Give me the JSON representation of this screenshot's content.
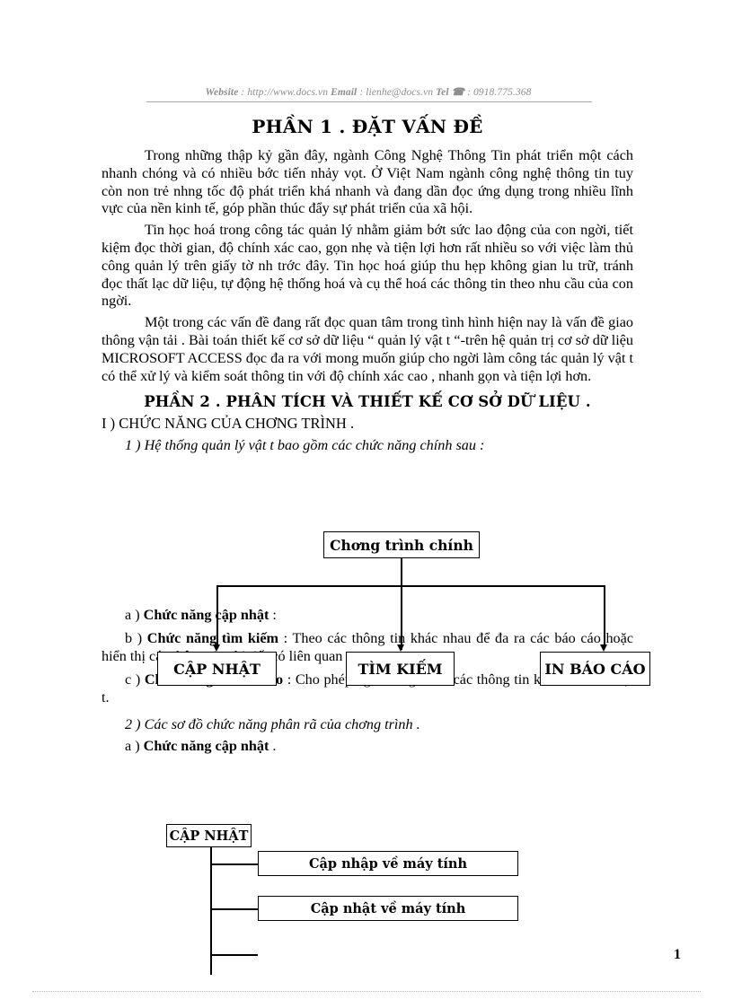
{
  "header": {
    "website_label": "Website",
    "website_sep": " : ",
    "website_url": "http://www.docs.vn",
    "email_label": "Email",
    "email_sep": "  : ",
    "email_value": "lienhe@docs.vn",
    "tel_label": "Tel",
    "tel_icon": "telephone-icon",
    "tel_glyph": "☎",
    "tel_sep": " : ",
    "tel_value": "0918.775.368"
  },
  "part1": {
    "title": "PHẦN 1 . ĐẶT VẤN ĐỀ",
    "paragraphs": [
      "Trong những thập kỷ gần đây, ngành Công Nghệ Thông Tin phát triển một cách nhanh chóng và có nhiều bớc   tiến nhảy vọt. Ở Việt Nam ngành công nghệ thông tin tuy còn non trẻ nhng   tốc độ phát triển khá nhanh và đang dần đọc   ứng dụng trong nhiều lĩnh vực của nền kinh tế, góp phần thúc đẩy sự phát triển của xã hội.",
      "Tin học hoá trong công tác quản lý nhằm giảm bớt sức lao động của con ngời,  tiết kiệm đọc   thời gian, độ chính xác cao, gọn nhẹ và tiện lợi hơn rất nhiều so với việc làm thủ công quản lý trên giấy tờ nh   trớc   đây. Tin học hoá giúp thu hẹp không gian lu   trữ, tránh đọc   thất lạc dữ liệu, tự động hệ thống hoá và cụ thể hoá các thông tin theo nhu cầu của con ngời.",
      "Một trong các vấn đề đang rất đọc   quan tâm trong tình hình hiện nay là vấn đề giao thông vận tải . Bài toán thiết kế cơ sở dữ liệu “ quản lý vật t  “-trên hệ quản trị cơ sở dữ liệu MICROSOFT ACCESS đọc   đa   ra với mong muốn giúp cho ngời   làm công tác quản lý vật t   có thể xử lý và kiểm soát thông tin với độ chính xác cao , nhanh gọn và tiện lợi hơn."
    ]
  },
  "part2": {
    "title": "PHẦN 2 . PHÂN TÍCH VÀ THIẾT KẾ CƠ SỞ DỮ LIỆU .",
    "section_1": "I ) CHỨC NĂNG CỦA CHƠNG   TRÌNH .",
    "item_1": "1 ) Hệ thống quản lý vật t   bao gồm các chức năng chính sau :",
    "item_2": "2 ) Các sơ đồ chức năng phân rã của chơng   trình ."
  },
  "diagram1": {
    "root_label": "Chơng   trình chính",
    "children": [
      {
        "label": "CẬP NHẬT"
      },
      {
        "label": "TÌM KIẾM"
      },
      {
        "label": "IN BÁO CÁO"
      }
    ]
  },
  "functions": [
    {
      "marker": "a ) ",
      "bold": "Chức năng cập nhật",
      "rest": " :"
    },
    {
      "marker": "b ) ",
      "bold": "Chức năng tìm kiếm",
      "rest": " : Theo các thông tin khác nhau để đa   ra các báo cáo hoặc hiển thị các thông tin chi tiết có liên quan ."
    },
    {
      "marker": "c ) ",
      "bold": "Chức năng In báo cáo",
      "rest": " : Cho phép ngời   dùng đa   ra các thông tin khác nhau về vật t."
    }
  ],
  "subsection_a": {
    "marker": "a ) ",
    "bold": "Chức năng cập nhật",
    "rest": " ."
  },
  "diagram2": {
    "root_label": "CẬP NHẬT",
    "children": [
      {
        "label": "Cập nhập về máy tính"
      },
      {
        "label": "Cập nhật về máy tính"
      },
      {
        "label": ""
      }
    ]
  },
  "footer": {
    "page_number": "1"
  },
  "colors": {
    "header_text": "#8d8d8d",
    "body_text": "#000000",
    "rule": "#a8a8a8",
    "page_bg": "#ffffff"
  }
}
